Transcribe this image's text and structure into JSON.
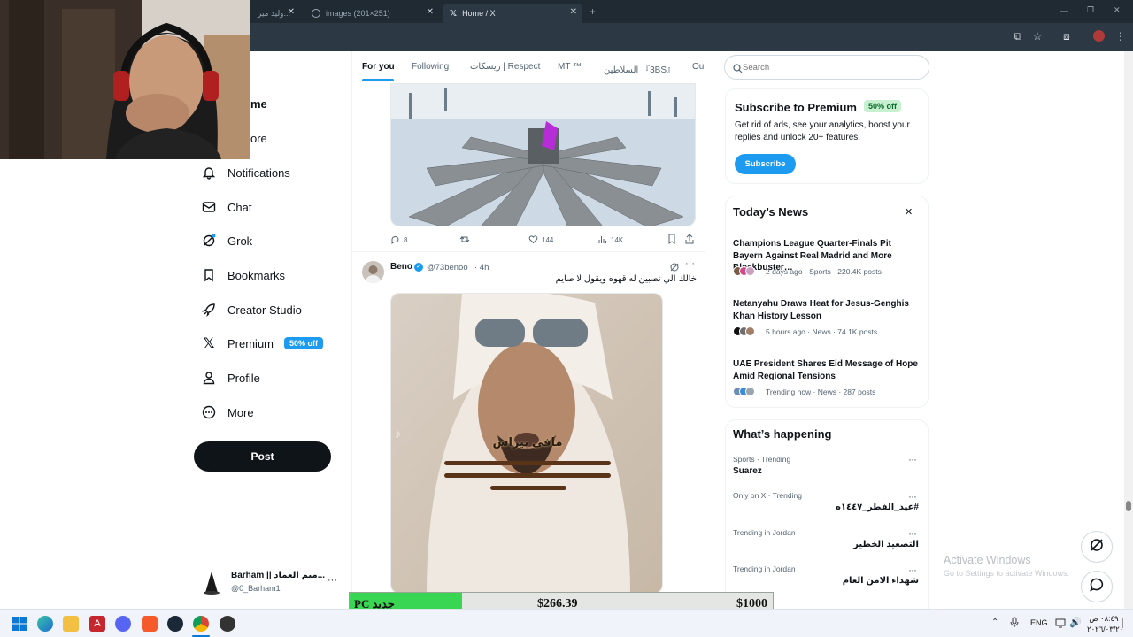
{
  "browser": {
    "tabs": [
      {
        "label": "وليد مير..."
      },
      {
        "label": "images (201×251)"
      },
      {
        "label": "Home / X"
      }
    ],
    "new_tab": "+",
    "window_controls": [
      "—",
      "❐",
      "✕"
    ]
  },
  "nav": {
    "partial_items": [
      "me",
      "ore"
    ],
    "items": [
      {
        "label": "Notifications",
        "icon": "bell-icon"
      },
      {
        "label": "Chat",
        "icon": "mail-icon"
      },
      {
        "label": "Grok",
        "icon": "grok-icon"
      },
      {
        "label": "Bookmarks",
        "icon": "bookmark-icon"
      },
      {
        "label": "Creator Studio",
        "icon": "rocket-icon"
      },
      {
        "label": "Premium",
        "icon": "x-logo-icon",
        "badge": "50% off"
      },
      {
        "label": "Profile",
        "icon": "person-icon"
      },
      {
        "label": "More",
        "icon": "more-circle-icon"
      }
    ],
    "post_label": "Post",
    "account": {
      "name": "Barham || ميم العماد...",
      "handle": "@0_Barham1",
      "menu": "···"
    }
  },
  "feed": {
    "tabs": [
      "For you",
      "Following",
      "ريسكات | Respect",
      "MT ™",
      "السلاطين 『3BS』",
      "Ou"
    ],
    "active_tab": "For you",
    "tweet1_actions": {
      "replies": "8",
      "reposts": "",
      "likes": "144",
      "views": "14K"
    },
    "tweet2": {
      "author": "Beno",
      "handle": "@73benoo",
      "time": "· 4h",
      "text": "خالك الي تصبين له قهوه ويقول لا صايم",
      "menu": "···",
      "video_caption": "مافي بيراس"
    }
  },
  "search": {
    "placeholder": "Search"
  },
  "premium_card": {
    "title": "Subscribe to Premium",
    "badge": "50% off",
    "body": "Get rid of ads, see your analytics, boost your replies and unlock 20+ features.",
    "button": "Subscribe"
  },
  "news": {
    "title": "Today’s News",
    "close": "✕",
    "items": [
      {
        "headline": "Champions League Quarter-Finals Pit Bayern Against Real Madrid and More Blockbuster…",
        "meta": "2 days ago · Sports · 220.4K posts"
      },
      {
        "headline": "Netanyahu Draws Heat for Jesus-Genghis Khan History Lesson",
        "meta": "5 hours ago · News · 74.1K posts"
      },
      {
        "headline": "UAE President Shares Eid Message of Hope Amid Regional Tensions",
        "meta": "Trending now · News · 287 posts"
      }
    ]
  },
  "happening": {
    "title": "What’s happening",
    "items": [
      {
        "category": "Sports · Trending",
        "name": "Suarez"
      },
      {
        "category": "Only on X · Trending",
        "name": "#عيد_الفطر_١٤٤٧ه"
      },
      {
        "category": "Trending in Jordan",
        "name": "التصعيد الخطير"
      },
      {
        "category": "Trending in Jordan",
        "name": "شهداء الامن العام"
      }
    ],
    "menu": "···"
  },
  "watermark": {
    "line1": "Activate Windows",
    "line2": "Go to Settings to activate Windows."
  },
  "donation": {
    "label": "PC جديد",
    "current": "$266.39",
    "goal": "$1000",
    "progress": 0.266
  },
  "taskbar": {
    "lang": "ENG",
    "time": "٠٨:٤٩ ص",
    "date": "٢٠٢٦/٠٣/٢٠"
  },
  "colors": {
    "accent": "#1d9bf0",
    "premium_badge": "#c6f0cf",
    "donation_fill": "#38d653"
  }
}
